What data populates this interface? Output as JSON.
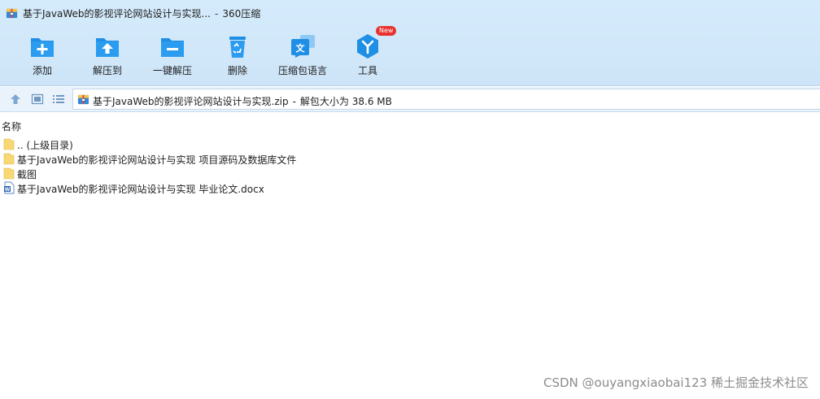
{
  "window": {
    "title": "基于JavaWeb的影视评论网站设计与实现...",
    "separator": "-",
    "app_name": "360压缩"
  },
  "toolbar": {
    "items": [
      {
        "label": "添加",
        "icon": "add-icon"
      },
      {
        "label": "解压到",
        "icon": "extract-to-icon"
      },
      {
        "label": "一键解压",
        "icon": "one-click-extract-icon"
      },
      {
        "label": "删除",
        "icon": "delete-icon"
      },
      {
        "label": "压缩包语言",
        "icon": "archive-language-icon"
      },
      {
        "label": "工具",
        "icon": "tools-icon",
        "badge": "New"
      }
    ]
  },
  "address": {
    "path": "基于JavaWeb的影视评论网站设计与实现.zip",
    "separator": "-",
    "size_info": "解包大小为 38.6 MB"
  },
  "file_list": {
    "column_name": "名称",
    "items": [
      {
        "name": ".. (上级目录)",
        "icon": "folder-icon"
      },
      {
        "name": "基于JavaWeb的影视评论网站设计与实现 项目源码及数据库文件",
        "icon": "folder-icon"
      },
      {
        "name": "截图",
        "icon": "folder-icon"
      },
      {
        "name": "基于JavaWeb的影视评论网站设计与实现 毕业论文.docx",
        "icon": "word-document-icon"
      }
    ]
  },
  "watermark": "CSDN @ouyangxiaobai123 稀土掘金技术社区",
  "colors": {
    "toolbar_icon_blue": "#1f8fe6",
    "title_gradient": "#d4ebfc",
    "address_bg": "#eaf3fc",
    "badge_red": "#e8322f",
    "folder_yellow": "#f8d775"
  }
}
